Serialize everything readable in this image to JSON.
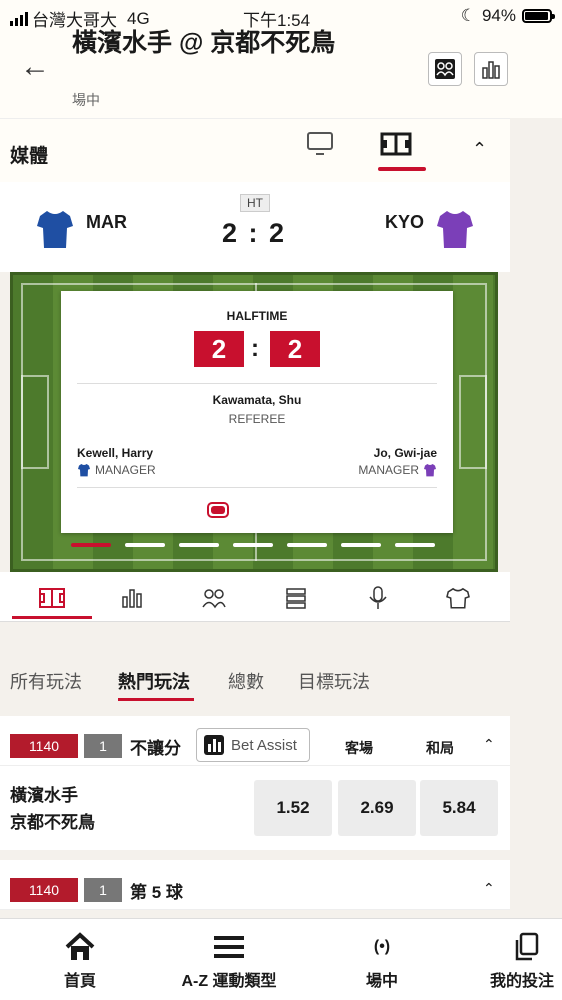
{
  "status": {
    "carrier": "台灣大哥大",
    "network": "4G",
    "time": "下午1:54",
    "battery": "94%"
  },
  "header": {
    "title": "橫濱水手 @ 京都不死鳥",
    "subtitle": "場中"
  },
  "media": {
    "label": "媒體"
  },
  "scoreboard": {
    "period": "HT",
    "home_code": "MAR",
    "away_code": "KYO",
    "score": "2 : 2",
    "home_color": "#1f4fa3",
    "away_color": "#7b3fb8"
  },
  "card": {
    "title": "HALFTIME",
    "home_score": "2",
    "away_score": "2",
    "referee_name": "Kawamata, Shu",
    "referee_role": "REFEREE",
    "home_manager": "Kewell, Harry",
    "home_manager_role": "MANAGER",
    "away_manager": "Jo, Gwi-jae",
    "away_manager_role": "MANAGER"
  },
  "tabs": [
    "所有玩法",
    "熱門玩法",
    "總數",
    "目標玩法"
  ],
  "market1": {
    "id": "1140",
    "num": "1",
    "title": "不讓分",
    "assist": "Bet Assist",
    "col_away": "客場",
    "col_draw": "和局",
    "home_team": "橫濱水手",
    "away_team": "京都不死鳥",
    "odds": [
      "1.52",
      "2.69",
      "5.84"
    ]
  },
  "market2": {
    "id": "1140",
    "num": "1",
    "title": "第 5 球"
  },
  "nav": [
    "首頁",
    "A-Z 運動類型",
    "場中",
    "我的投注"
  ],
  "colors": {
    "accent": "#c8102e",
    "pitch": "#4d7a2c"
  }
}
